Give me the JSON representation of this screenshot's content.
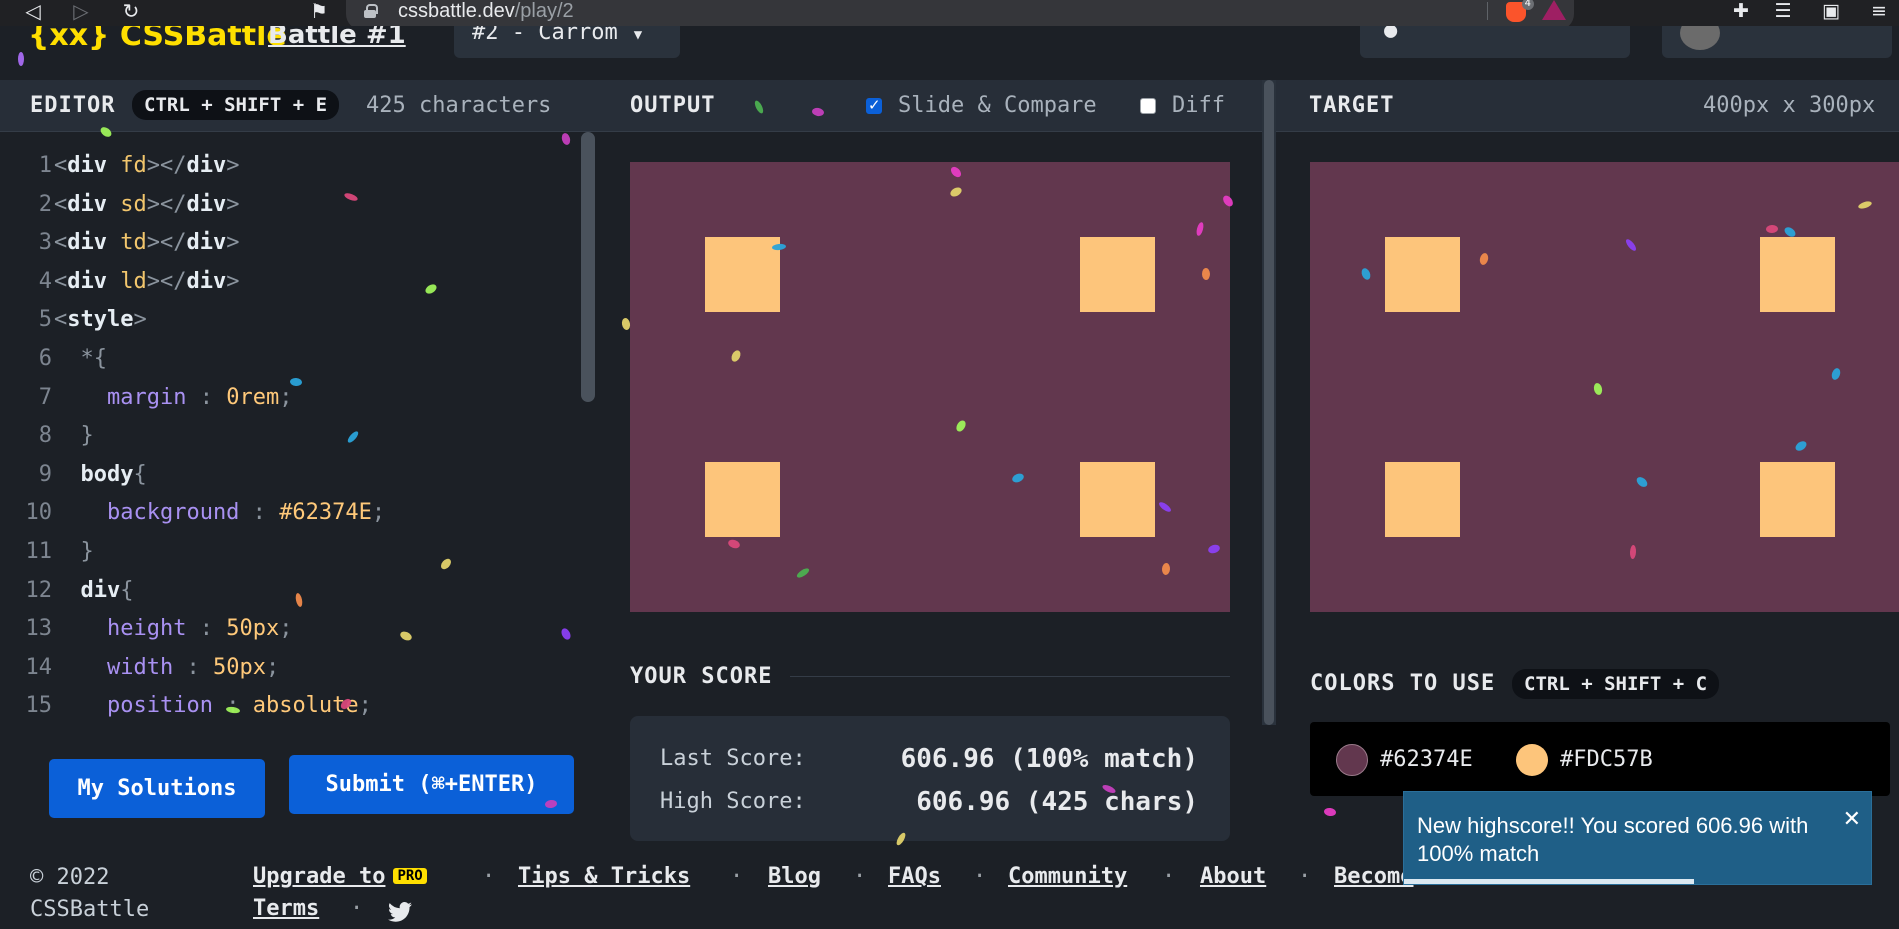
{
  "browser": {
    "url_host": "cssbattle.dev",
    "url_path": "/play/2",
    "nav": [
      {
        "name": "back-icon",
        "glyph": "◁"
      },
      {
        "name": "forward-icon",
        "glyph": "▷"
      },
      {
        "name": "reload-icon",
        "glyph": "↻"
      },
      {
        "name": "bookmark-icon",
        "glyph": "⚑"
      }
    ],
    "brave_badge": "4"
  },
  "header": {
    "logo": "{xx} CSSBattle",
    "battle": "Battle #1",
    "target_select": "#2 - Carrom"
  },
  "editor": {
    "title": "EDITOR",
    "shortcut": "CTRL + SHIFT + E",
    "char_count": "425 characters",
    "lines": [
      {
        "n": "1",
        "tokens": [
          [
            "br",
            "<"
          ],
          [
            "tag",
            "div"
          ],
          [
            "attr",
            " fd"
          ],
          [
            "br",
            "></"
          ],
          [
            "tag",
            "div"
          ],
          [
            "br",
            ">"
          ]
        ]
      },
      {
        "n": "2",
        "tokens": [
          [
            "br",
            "<"
          ],
          [
            "tag",
            "div"
          ],
          [
            "attr",
            " sd"
          ],
          [
            "br",
            "></"
          ],
          [
            "tag",
            "div"
          ],
          [
            "br",
            ">"
          ]
        ]
      },
      {
        "n": "3",
        "tokens": [
          [
            "br",
            "<"
          ],
          [
            "tag",
            "div"
          ],
          [
            "attr",
            " td"
          ],
          [
            "br",
            "></"
          ],
          [
            "tag",
            "div"
          ],
          [
            "br",
            ">"
          ]
        ]
      },
      {
        "n": "4",
        "tokens": [
          [
            "br",
            "<"
          ],
          [
            "tag",
            "div"
          ],
          [
            "attr",
            " ld"
          ],
          [
            "br",
            "></"
          ],
          [
            "tag",
            "div"
          ],
          [
            "br",
            ">"
          ]
        ]
      },
      {
        "n": "5",
        "tokens": [
          [
            "br",
            "<"
          ],
          [
            "tag",
            "style"
          ],
          [
            "br",
            ">"
          ]
        ]
      },
      {
        "n": "6",
        "tokens": [
          [
            "br",
            "  *{"
          ]
        ]
      },
      {
        "n": "7",
        "tokens": [
          [
            "prop",
            "    margin"
          ],
          [
            "br",
            " : "
          ],
          [
            "val",
            "0rem"
          ],
          [
            "br",
            ";"
          ]
        ]
      },
      {
        "n": "8",
        "tokens": [
          [
            "br",
            "  }"
          ]
        ]
      },
      {
        "n": "9",
        "tokens": [
          [
            "tag",
            "  body"
          ],
          [
            "br",
            "{"
          ]
        ]
      },
      {
        "n": "10",
        "tokens": [
          [
            "prop",
            "    background"
          ],
          [
            "br",
            " : "
          ],
          [
            "val",
            "#62374E"
          ],
          [
            "br",
            ";"
          ]
        ]
      },
      {
        "n": "11",
        "tokens": [
          [
            "br",
            "  }"
          ]
        ]
      },
      {
        "n": "12",
        "tokens": [
          [
            "tag",
            "  div"
          ],
          [
            "br",
            "{"
          ]
        ]
      },
      {
        "n": "13",
        "tokens": [
          [
            "prop",
            "    height"
          ],
          [
            "br",
            " : "
          ],
          [
            "val",
            "50px"
          ],
          [
            "br",
            ";"
          ]
        ]
      },
      {
        "n": "14",
        "tokens": [
          [
            "prop",
            "    width"
          ],
          [
            "br",
            " : "
          ],
          [
            "val",
            "50px"
          ],
          [
            "br",
            ";"
          ]
        ]
      },
      {
        "n": "15",
        "tokens": [
          [
            "prop",
            "    position"
          ],
          [
            "br",
            " : "
          ],
          [
            "val",
            "absolute"
          ],
          [
            "br",
            ";"
          ]
        ]
      }
    ],
    "my_solutions": "My Solutions",
    "submit": "Submit (⌘+ENTER)"
  },
  "output": {
    "title": "OUTPUT",
    "slide_compare": "Slide & Compare",
    "slide_compare_checked": true,
    "diff": "Diff",
    "diff_checked": false,
    "bg_color": "#62374E",
    "shape_color": "#FDC57B"
  },
  "target": {
    "title": "TARGET",
    "size": "400px x 300px"
  },
  "score": {
    "heading": "YOUR SCORE",
    "last_label": "Last Score:",
    "last_value": "606.96 (100% match)",
    "high_label": "High Score:",
    "high_value": "606.96 (425 chars)"
  },
  "colors": {
    "heading": "COLORS TO USE",
    "shortcut": "CTRL + SHIFT + C",
    "items": [
      {
        "hex": "#62374E",
        "label": "#62374E"
      },
      {
        "hex": "#FDC57B",
        "label": "#FDC57B"
      }
    ]
  },
  "toast": {
    "message": "New highscore!! You scored 606.96 with 100% match",
    "close": "✕"
  },
  "footer": {
    "copyright_line1": "© 2022",
    "copyright_line2": "CSSBattle",
    "links": [
      "Upgrade to",
      "Tips & Tricks",
      "Blog",
      "FAQs",
      "Community",
      "About",
      "Become"
    ],
    "pro_badge": "PRO",
    "terms": "Terms",
    "twitter_icon": "twitter-icon"
  }
}
